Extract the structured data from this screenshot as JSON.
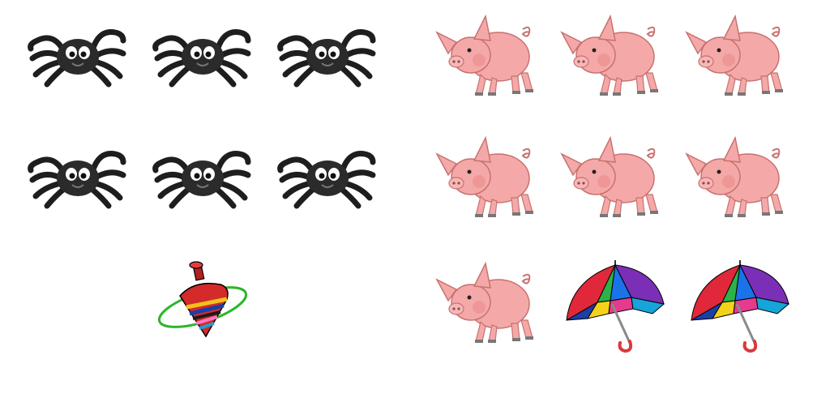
{
  "left_group": {
    "items": [
      {
        "icon": "spider-icon"
      },
      {
        "icon": "spider-icon"
      },
      {
        "icon": "spider-icon"
      },
      {
        "icon": "spider-icon"
      },
      {
        "icon": "spider-icon"
      },
      {
        "icon": "spider-icon"
      },
      {
        "icon": "spinning-top-icon"
      }
    ],
    "counts": {
      "spiders": 6,
      "spinning_tops": 1
    }
  },
  "right_group": {
    "items": [
      {
        "icon": "pig-icon"
      },
      {
        "icon": "pig-icon"
      },
      {
        "icon": "pig-icon"
      },
      {
        "icon": "pig-icon"
      },
      {
        "icon": "pig-icon"
      },
      {
        "icon": "pig-icon"
      },
      {
        "icon": "pig-icon"
      },
      {
        "icon": "umbrella-icon"
      },
      {
        "icon": "umbrella-icon"
      }
    ],
    "counts": {
      "pigs": 7,
      "umbrellas": 2
    }
  },
  "colors": {
    "spider_body": "#2b2b2b",
    "pig_body": "#f4a9a8",
    "pig_outline": "#c8716f",
    "top_red": "#d42a2a",
    "top_ring": "#2ab62a",
    "umbrella_handle": "#d83a3a"
  }
}
